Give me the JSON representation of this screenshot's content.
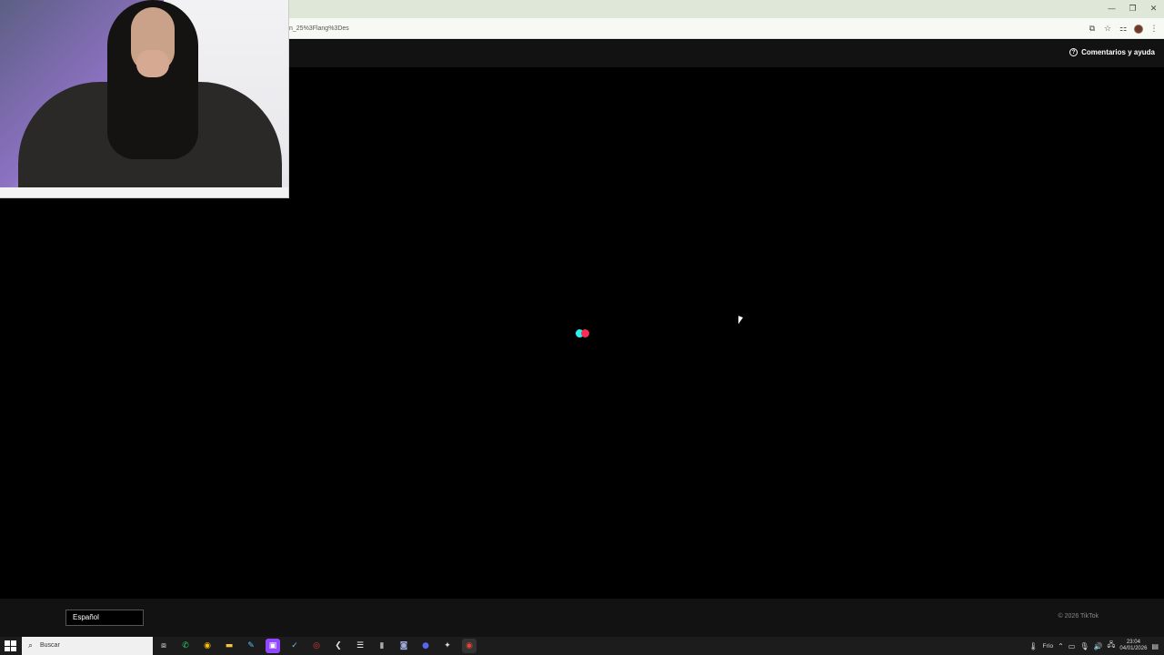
{
  "browser": {
    "url_text": "n_25%3Flang%3Des",
    "window_controls": [
      "minimize-icon",
      "restore-icon",
      "close-icon"
    ],
    "toolbar_icons": [
      "cast-icon",
      "star-icon",
      "extensions-icon",
      "profile-avatar",
      "menu-icon"
    ]
  },
  "page": {
    "help_label": "Comentarios y ayuda",
    "loader_colors": {
      "cyan": "#25f4ee",
      "pink": "#fe2c55"
    },
    "language_value": "Español",
    "copyright": "© 2026 TikTok"
  },
  "taskbar": {
    "search_placeholder": "Buscar",
    "apps": [
      "task-view-icon",
      "whatsapp-icon",
      "chrome-icon",
      "file-explorer-icon",
      "notepad-icon",
      "twitch-icon",
      "steam-icon",
      "obs-icon",
      "app-icon",
      "spotify-icon",
      "mic-icon",
      "camera-icon",
      "discord-icon",
      "tools-icon",
      "chrome-active-icon"
    ],
    "weather": "Frío",
    "time": "23:04",
    "date": "04/01/2026"
  }
}
